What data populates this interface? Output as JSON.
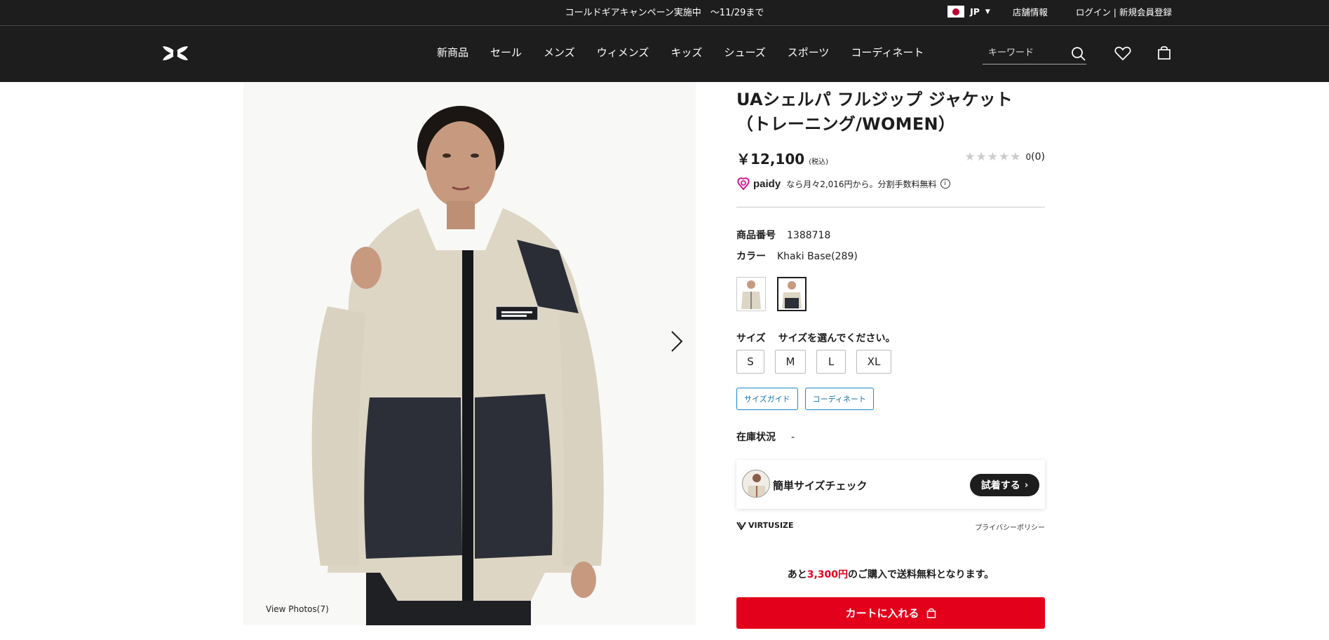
{
  "topbar": {
    "promo": "コールドギアキャンペーン実施中　〜11/29まで",
    "country": "JP",
    "store_info": "店舗情報",
    "login": "ログイン | 新規会員登録"
  },
  "nav": {
    "menu": [
      "新商品",
      "セール",
      "メンズ",
      "ウィメンズ",
      "キッズ",
      "シューズ",
      "スポーツ",
      "コーディネート"
    ],
    "search_placeholder": "キーワード"
  },
  "gallery": {
    "view_photos": "View Photos(7)"
  },
  "product": {
    "title": "UAシェルパ フルジップ ジャケット（トレーニング/WOMEN）",
    "price": "￥12,100",
    "tax_note": "(税込)",
    "rating_value": "0",
    "review_count": "(0)",
    "paidy": {
      "brand": "paidy",
      "text": "なら月々2,016円から。分割手数料無料"
    },
    "product_number_label": "商品番号",
    "product_number": "1388718",
    "color_label": "カラー",
    "color_value": "Khaki Base(289)",
    "size_label": "サイズ",
    "size_prompt": "サイズを選んでください。",
    "sizes": [
      "S",
      "M",
      "L",
      "XL"
    ],
    "size_guide": "サイズガイド",
    "coordinate": "コーディネート",
    "stock_label": "在庫状況",
    "stock_value": "-",
    "virtusize": {
      "text": "簡単サイズチェック",
      "button": "試着する",
      "brand": "VIRTUSIZE",
      "policy": "プライバシーポリシー"
    },
    "shipping": {
      "prefix": "あと",
      "amount": "3,300円",
      "suffix": "のご購入で送料無料となります。"
    },
    "cart_button": "カートに入れる"
  },
  "colors": {
    "accent_red": "#e3001a",
    "header_bg": "#1d1d1d",
    "link_blue": "#1a87c9"
  }
}
